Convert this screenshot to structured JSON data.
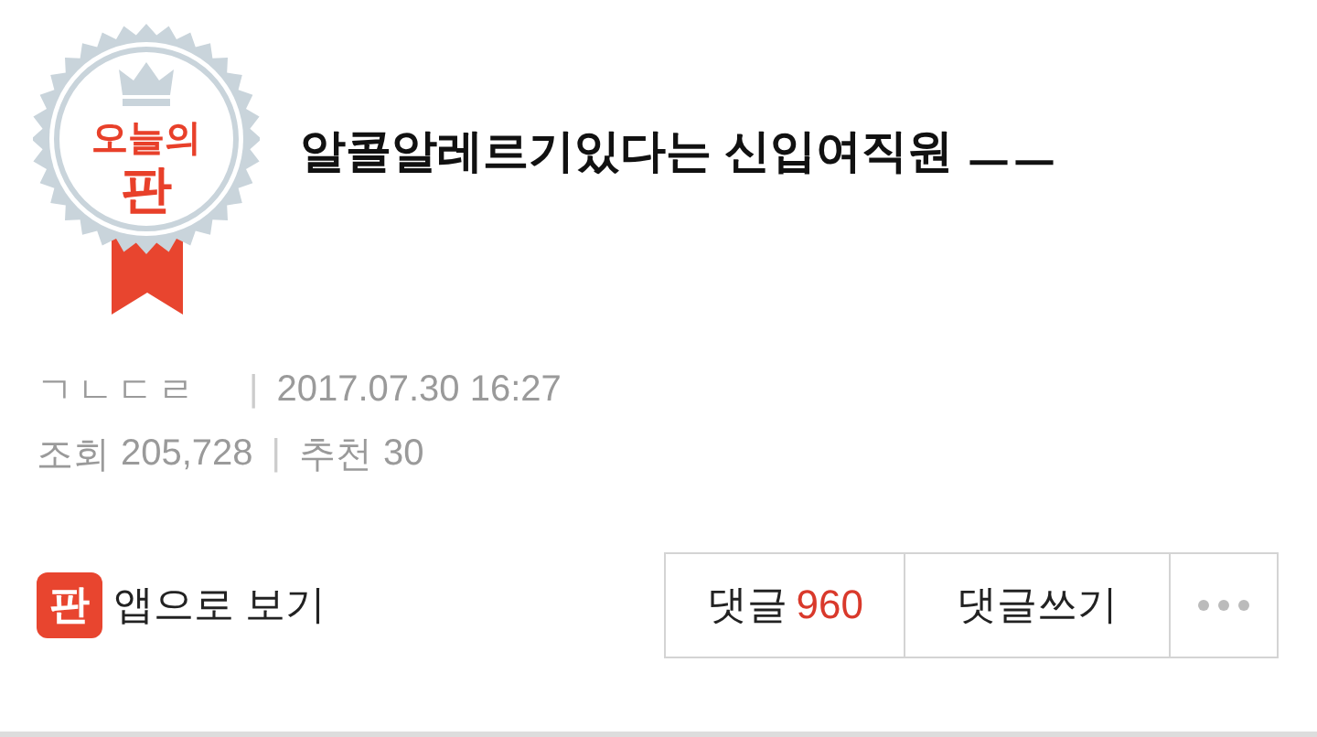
{
  "badge": {
    "line_1": "오늘의",
    "line_2": "판"
  },
  "title": "알콜알레르기있다는 신입여직원 ㅡㅡ",
  "meta": {
    "author": "ㄱㄴㄷㄹ",
    "separator_1": "|",
    "date": "2017.07.30 16:27",
    "views_label": "조회",
    "views": "205,728",
    "separator_2": "|",
    "likes_label": "추천",
    "likes": "30"
  },
  "app_link": {
    "icon_text": "판",
    "label": "앱으로 보기"
  },
  "actions": {
    "comments_label": "댓글",
    "comments_count": "960",
    "write_comment": "댓글쓰기"
  }
}
